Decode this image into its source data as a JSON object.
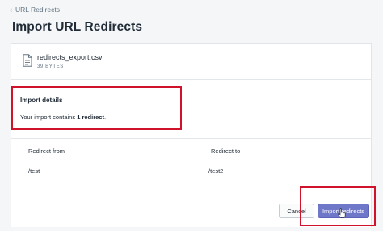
{
  "breadcrumb": {
    "label": "URL Redirects"
  },
  "page": {
    "title": "Import URL Redirects"
  },
  "file": {
    "name": "redirects_export.csv",
    "size": "39 BYTES"
  },
  "import_details": {
    "heading": "Import details",
    "text_prefix": "Your import contains",
    "count_text": "1 redirect",
    "text_suffix": "."
  },
  "table": {
    "headers": [
      "Redirect from",
      "Redirect to"
    ],
    "rows": [
      [
        "/test",
        "/test2"
      ]
    ]
  },
  "actions": {
    "cancel_label": "Cancel",
    "import_label": "Import redirects"
  },
  "colors": {
    "primary": "#6f77c8",
    "highlight": "#d0122b",
    "background": "#f4f6f8"
  },
  "icons": {
    "breadcrumb": "chevron-left-icon",
    "file": "file-icon",
    "pointer": "hand-pointer-icon"
  }
}
